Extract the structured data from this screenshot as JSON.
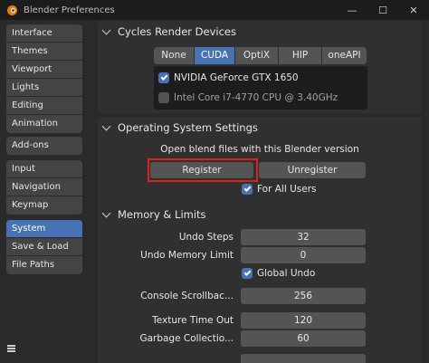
{
  "window": {
    "title": "Blender Preferences",
    "controls": [
      "—",
      "☐",
      "✕"
    ]
  },
  "sidebar": {
    "groups": [
      [
        "Interface",
        "Themes",
        "Viewport",
        "Lights",
        "Editing",
        "Animation"
      ],
      [
        "Add-ons"
      ],
      [
        "Input",
        "Navigation",
        "Keymap"
      ],
      [
        "System",
        "Save & Load",
        "File Paths"
      ]
    ],
    "active": "System"
  },
  "cycles": {
    "title": "Cycles Render Devices",
    "tabs": [
      "None",
      "CUDA",
      "OptiX",
      "HIP",
      "oneAPI"
    ],
    "active_tab": "CUDA",
    "devices": [
      {
        "name": "NVIDIA GeForce GTX 1650",
        "checked": true
      },
      {
        "name": "Intel Core i7-4770 CPU @ 3.40GHz",
        "checked": false
      }
    ]
  },
  "os": {
    "title": "Operating System Settings",
    "label": "Open blend files with this Blender version",
    "register": "Register",
    "unregister": "Unregister",
    "for_all_users": "For All Users",
    "for_all_users_checked": true
  },
  "memory": {
    "title": "Memory & Limits",
    "undo_steps_label": "Undo Steps",
    "undo_steps": "32",
    "undo_memory_label": "Undo Memory Limit",
    "undo_memory": "0",
    "global_undo": "Global Undo",
    "global_undo_checked": true,
    "console_label": "Console Scrollbac...",
    "console": "256",
    "texture_label": "Texture Time Out",
    "texture": "120",
    "garbage_label": "Garbage Collectio...",
    "garbage": "60"
  },
  "colors": {
    "accent": "#4772b3",
    "highlight": "#e0201b",
    "panel": "#303030",
    "button": "#545454"
  }
}
